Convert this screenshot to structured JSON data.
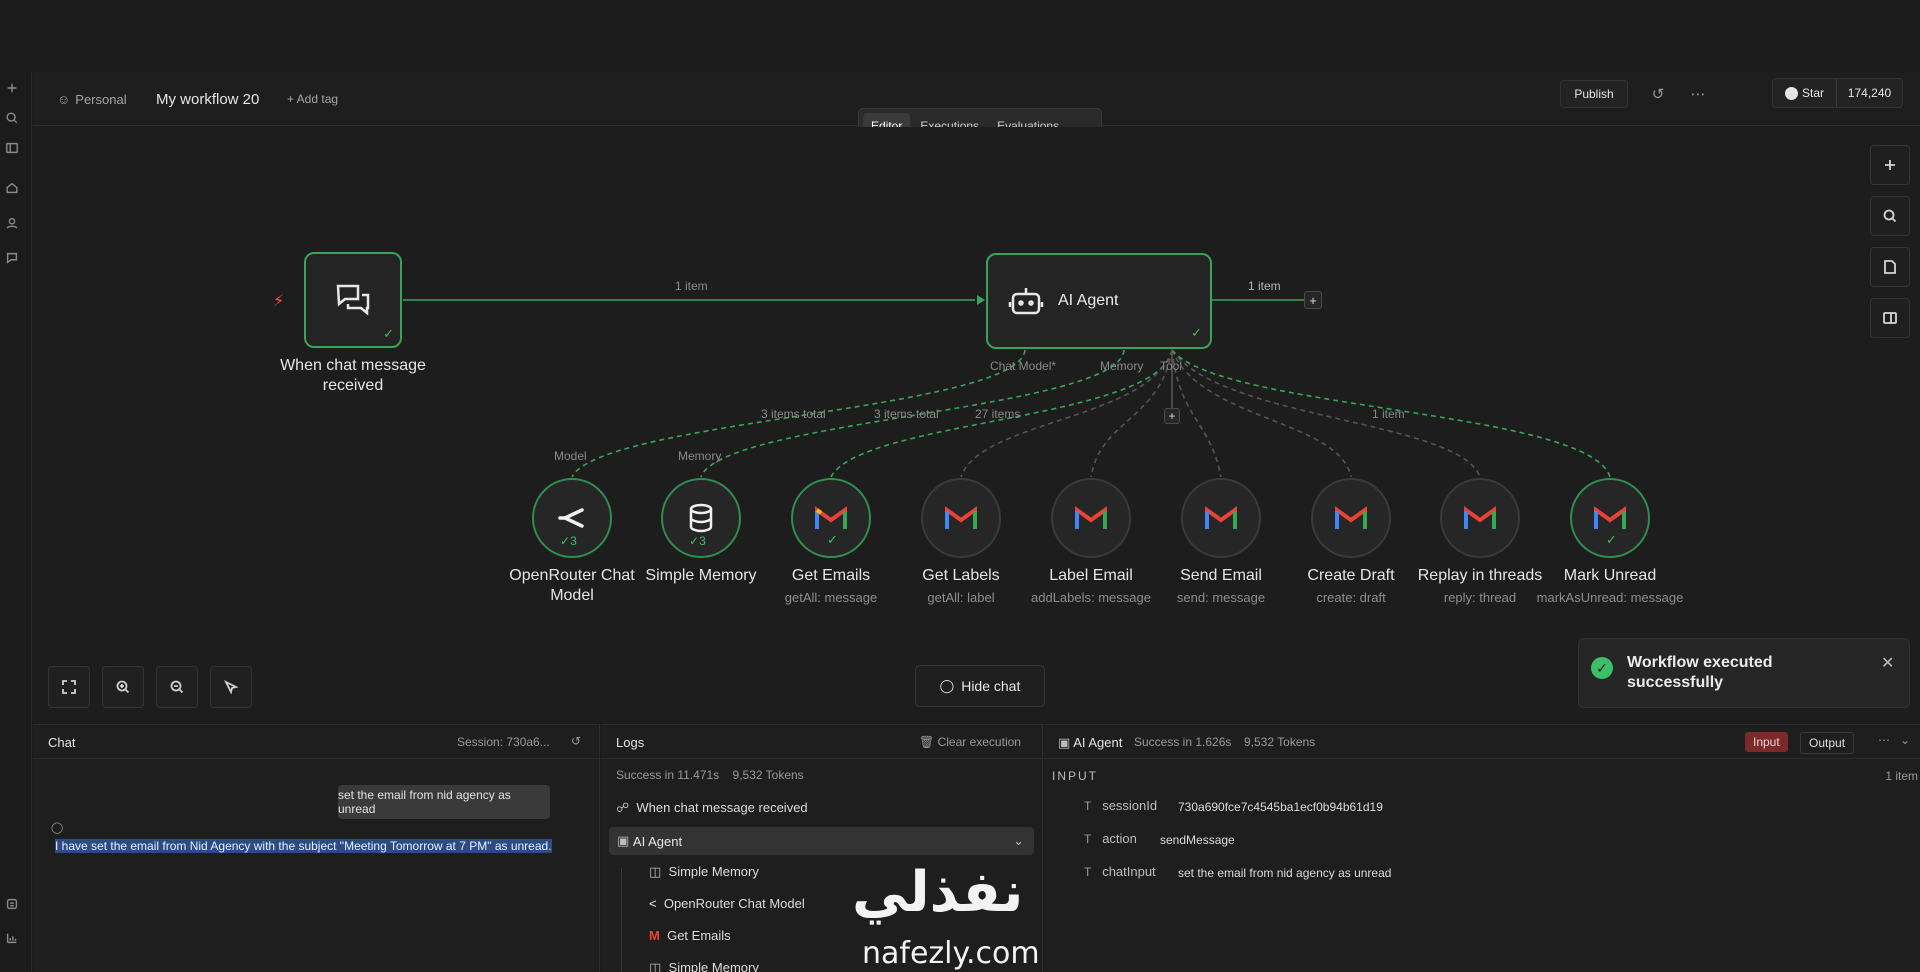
{
  "header": {
    "workspace": "Personal",
    "workflow_name": "My workflow 20",
    "add_tag": "+ Add tag",
    "publish": "Publish",
    "star": "Star",
    "star_count": "174,240"
  },
  "tabs": [
    {
      "label": "Editor"
    },
    {
      "label": "Executions"
    },
    {
      "label": "Evaluations"
    }
  ],
  "canvas": {
    "trigger": {
      "label": "When chat message received"
    },
    "agent": {
      "label": "AI Agent",
      "ports": [
        "Chat Model*",
        "Memory",
        "Tool"
      ]
    },
    "edge_labels": {
      "main": "1 item",
      "out": "1 item",
      "model": "3 items total",
      "memory": "3 items total",
      "tool_emails": "27 items",
      "tool_mark": "1 item"
    },
    "sub_ports": {
      "model": "Model",
      "memory": "Memory"
    },
    "tools": [
      {
        "label": "OpenRouter Chat Model",
        "sub": "",
        "badge": "3"
      },
      {
        "label": "Simple Memory",
        "sub": "",
        "badge": "3"
      },
      {
        "label": "Get Emails",
        "sub": "getAll: message",
        "badge": ""
      },
      {
        "label": "Get Labels",
        "sub": "getAll: label",
        "badge": ""
      },
      {
        "label": "Label Email",
        "sub": "addLabels: message",
        "badge": ""
      },
      {
        "label": "Send Email",
        "sub": "send: message",
        "badge": ""
      },
      {
        "label": "Create Draft",
        "sub": "create: draft",
        "badge": ""
      },
      {
        "label": "Replay in threads",
        "sub": "reply: thread",
        "badge": ""
      },
      {
        "label": "Mark Unread",
        "sub": "markAsUnread: message",
        "badge": ""
      }
    ],
    "hide_chat": "Hide chat",
    "toast": "Workflow executed successfully"
  },
  "chat": {
    "title": "Chat",
    "session": "Session: 730a6...",
    "user_msg": "set the email from nid agency as unread",
    "bot_msg": "I have set the email from Nid Agency with the subject \"Meeting Tomorrow at 7 PM\" as unread."
  },
  "logs": {
    "title": "Logs",
    "clear": "Clear execution",
    "summary_status": "Success in 11.471s",
    "summary_tokens": "9,532 Tokens",
    "items": [
      {
        "label": "When chat message received"
      },
      {
        "label": "AI Agent"
      },
      {
        "label": "Simple Memory"
      },
      {
        "label": "OpenRouter Chat Model"
      },
      {
        "label": "Get Emails"
      },
      {
        "label": "Simple Memory"
      }
    ]
  },
  "detail": {
    "node": "AI Agent",
    "status": "Success in 1.626s",
    "tokens": "9,532 Tokens",
    "input_tab": "Input",
    "output_tab": "Output",
    "section": "INPUT",
    "count": "1 item",
    "fields": [
      {
        "key": "sessionId",
        "value": "730a690fce7c4545ba1ecf0b94b61d19"
      },
      {
        "key": "action",
        "value": "sendMessage"
      },
      {
        "key": "chatInput",
        "value": "set the email from nid agency as unread"
      }
    ]
  },
  "watermark": {
    "arabic": "نفذلي",
    "latin": "nafezly.com"
  },
  "colors": {
    "accent_green": "#3bbf67",
    "input_tab": "#7a2a2a",
    "highlight": "#2c4b84"
  }
}
